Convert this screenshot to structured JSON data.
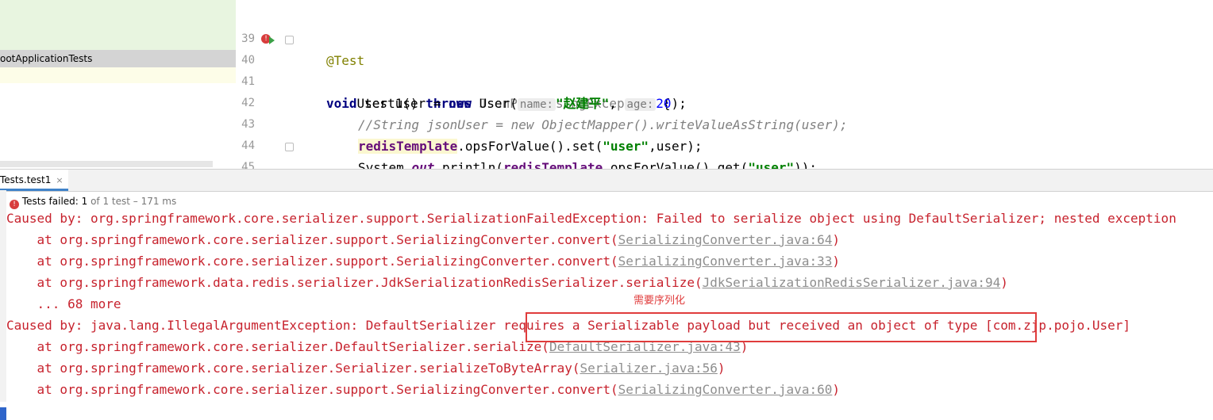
{
  "project_panel": {
    "selected_item": "ootApplicationTests"
  },
  "editor": {
    "lines": [
      {
        "num": "39"
      },
      {
        "num": "40"
      },
      {
        "num": "41"
      },
      {
        "num": "42"
      },
      {
        "num": "43"
      },
      {
        "num": "44"
      },
      {
        "num": "45"
      }
    ],
    "l39_annotation": "@Test",
    "l40_void": "void",
    "l40_sig": " test1() ",
    "l40_throws": "throws",
    "l40_exc": " JsonProcessingException",
    "l40_brace": " {",
    "l41_indent": "    ",
    "l41_a": "User user = ",
    "l41_new": "new",
    "l41_b": " User(",
    "l41_hint_name": "name:",
    "l41_str": "\"赵建平\"",
    "l41_c": ", ",
    "l41_hint_age": "age:",
    "l41_num": "20",
    "l41_d": ");",
    "l42_comment": "//String jsonUser = new ObjectMapper().writeValueAsString(user);",
    "l43_field": "redisTemplate",
    "l43_a": ".opsForValue().set(",
    "l43_str": "\"user\"",
    "l43_b": ",user);",
    "l44_a": "System.",
    "l44_out": "out",
    "l44_b": ".println(",
    "l44_field": "redisTemplate",
    "l44_c": ".opsForValue().get(",
    "l44_str": "\"user\"",
    "l44_d": "));",
    "l45_brace": "}"
  },
  "run_tab": {
    "label": "Tests.test1",
    "close": "×"
  },
  "status": {
    "icon": "!",
    "failed_label": "Tests failed: 1",
    "detail": " of 1 test – 171 ms"
  },
  "console": {
    "l1": "Caused by: org.springframework.core.serializer.support.SerializationFailedException: Failed to serialize object using DefaultSerializer; nested exception",
    "l2_a": "    at org.springframework.core.serializer.support.SerializingConverter.convert(",
    "l2_link": "SerializingConverter.java:64",
    "l2_b": ")",
    "l3_a": "    at org.springframework.core.serializer.support.SerializingConverter.convert(",
    "l3_link": "SerializingConverter.java:33",
    "l3_b": ")",
    "l4_a": "    at org.springframework.data.redis.serializer.JdkSerializationRedisSerializer.serialize(",
    "l4_link": "JdkSerializationRedisSerializer.java:94",
    "l4_b": ")",
    "l5": "    ... 68 more",
    "l6": "Caused by: java.lang.IllegalArgumentException: DefaultSerializer requires a Serializable payload but received an object of type [com.zjp.pojo.User]",
    "l7_a": "    at org.springframework.core.serializer.DefaultSerializer.serialize(",
    "l7_link": "DefaultSerializer.java:43",
    "l7_b": ")",
    "l8_a": "    at org.springframework.core.serializer.Serializer.serializeToByteArray(",
    "l8_link": "Serializer.java:56",
    "l8_b": ")",
    "l9_a": "    at org.springframework.core.serializer.support.SerializingConverter.convert(",
    "l9_link": "SerializingConverter.java:60",
    "l9_b": ")"
  },
  "annotation_text": "需要序列化",
  "colors": {
    "error_text": "#c7222d",
    "highlight_box": "#e03c3c",
    "tab_accent": "#4083c9"
  }
}
